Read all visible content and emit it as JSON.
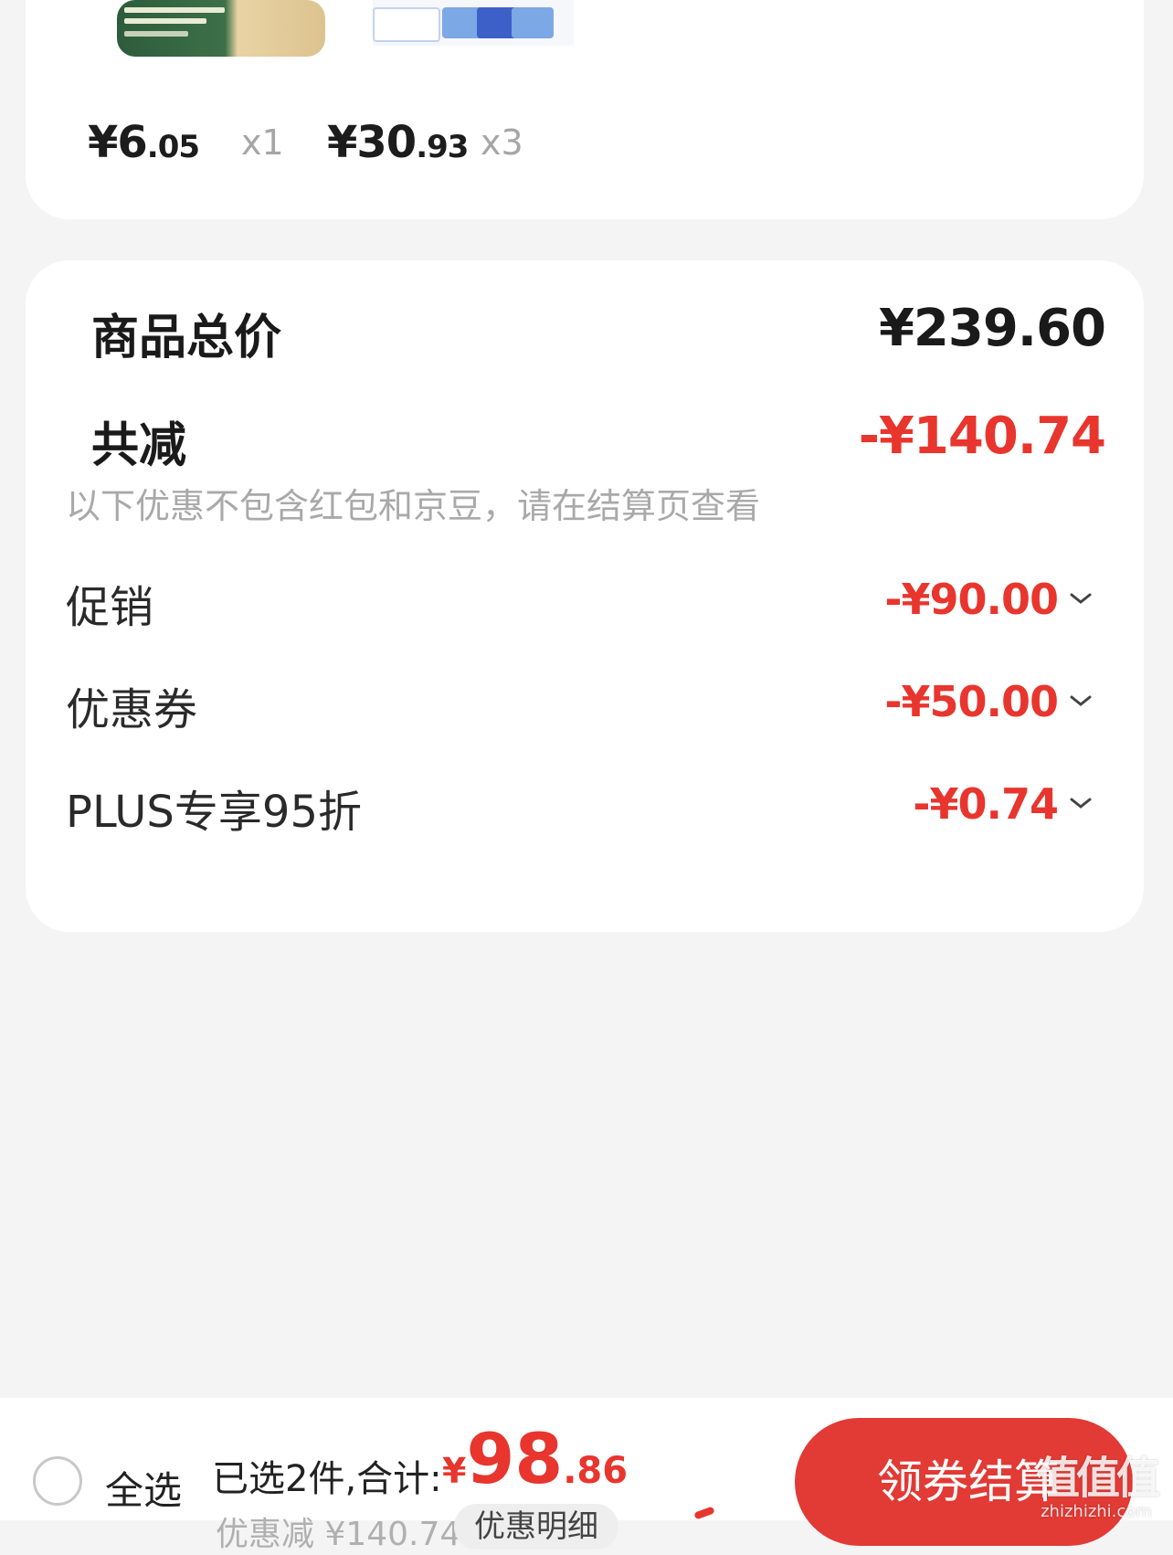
{
  "products": [
    {
      "price_int": "¥6",
      "price_dec": ".05",
      "qty": "x1"
    },
    {
      "price_int": "¥30",
      "price_dec": ".93",
      "qty": "x3"
    }
  ],
  "summary": {
    "total_label": "商品总价",
    "total_value": "¥239.60",
    "reduce_label": "共减",
    "reduce_value": "-¥140.74",
    "notice": "以下优惠不包含红包和京豆，请在结算页查看",
    "items": [
      {
        "label": "促销",
        "value": "-¥90.00"
      },
      {
        "label": "优惠券",
        "value": "-¥50.00"
      },
      {
        "label": "PLUS专享95折",
        "value": "-¥0.74"
      }
    ]
  },
  "bottom_bar": {
    "select_all": "全选",
    "selected_summary": "已选2件,合计:",
    "total_yen": "¥",
    "total_int": "98",
    "total_dec": ".86",
    "discount_hint": "优惠减 ¥140.74",
    "detail_label": "优惠明细",
    "checkout_label": "领券结算"
  },
  "watermark": {
    "mark": "值值值",
    "site": "zhizhizhi.com"
  },
  "colors": {
    "accent": "#e8352d",
    "checkout": "#e23a35",
    "page_bg": "#f4f4f4"
  }
}
